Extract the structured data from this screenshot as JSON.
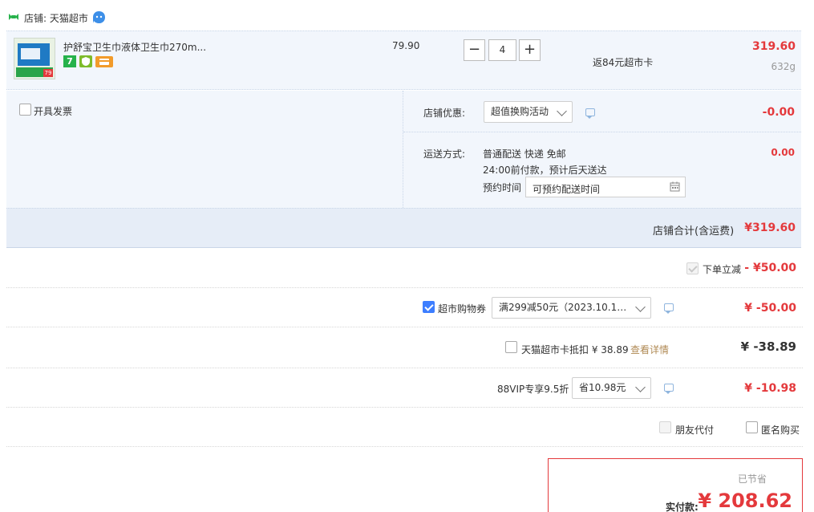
{
  "shop": {
    "label": "店铺: 天猫超市"
  },
  "product": {
    "name": "护舒宝卫生巾液体卫生巾270m...",
    "price": "79.90",
    "quantity": "4",
    "qty_minus": "−",
    "qty_plus": "+",
    "rebate": "返84元超市卡",
    "subtotal": "319.60",
    "weight": "632g",
    "thumb_price": "79"
  },
  "invoice": {
    "label": "开具发票"
  },
  "shop_discount": {
    "label": "店铺优惠:",
    "select_value": "超值换购活动",
    "amount": "-0.00"
  },
  "shipping": {
    "label": "运送方式:",
    "line1": "普通配送 快递 免邮",
    "line2": "24:00前付款，预计后天送达",
    "schedule_label": "预约时间",
    "schedule_placeholder": "可预约配送时间",
    "amount": "0.00"
  },
  "shop_total": {
    "label": "店铺合计(含运费)",
    "amount": "¥319.60"
  },
  "instant_discount": {
    "label": "下单立减",
    "amount": "- ¥50.00"
  },
  "coupon": {
    "label": "超市购物券",
    "select_value": "满299减50元（2023.10.19 ...",
    "amount": "¥ -50.00"
  },
  "supermarket_card": {
    "label": "天猫超市卡抵扣 ¥ 38.89",
    "details_link": "查看详情",
    "amount": "¥ -38.89"
  },
  "vip": {
    "label": "88VIP专享9.5折",
    "select_value": "省10.98元",
    "amount": "¥ -10.98"
  },
  "friend_pay": {
    "label": "朋友代付"
  },
  "anonymous": {
    "label": "匿名购买"
  },
  "footer": {
    "saved": "已节省",
    "pay_label": "实付款:",
    "pay_amount": "¥ 208.62"
  },
  "colors": {
    "accent_red": "#e4393c",
    "highlight_bg": "#f2f6fc",
    "checkbox_blue": "#3d7eff"
  }
}
